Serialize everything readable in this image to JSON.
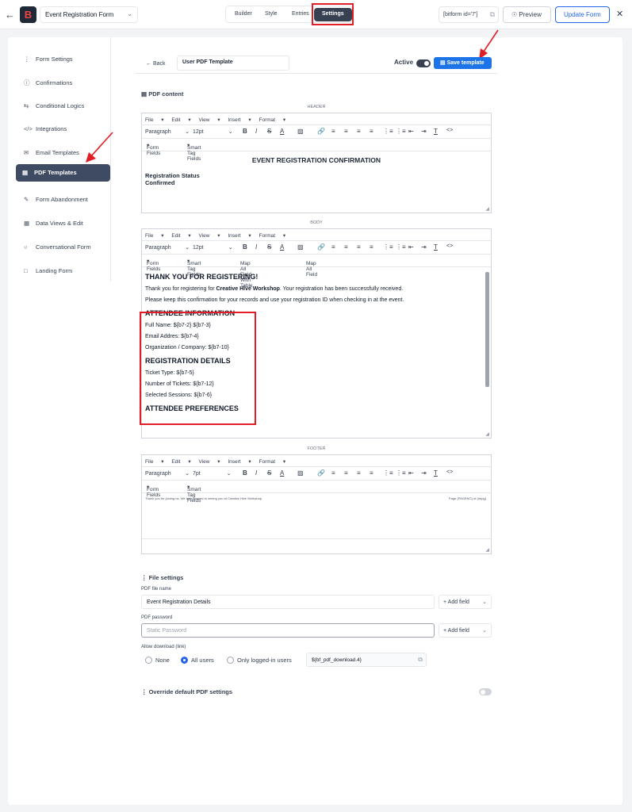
{
  "topbar": {
    "back_icon": "arrow-left-icon",
    "form_name": "Event Registration Form",
    "nav": [
      "Builder",
      "Style",
      "Entries",
      "Settings"
    ],
    "active_nav": "Settings",
    "shortcode": "[bitform id='7']",
    "preview_label": "Preview",
    "update_label": "Update Form"
  },
  "sidebar": {
    "items": [
      {
        "label": "Form Settings",
        "icon": "sliders-icon"
      },
      {
        "label": "Confirmations",
        "icon": "info-circle-icon"
      },
      {
        "label": "Conditional Logics",
        "icon": "branch-icon"
      },
      {
        "label": "Integrations",
        "icon": "code-icon"
      },
      {
        "label": "Email Templates",
        "icon": "mail-icon"
      },
      {
        "label": "PDF Templates",
        "icon": "file-icon"
      },
      {
        "label": "Form Abandonment",
        "icon": "form-icon"
      },
      {
        "label": "Data Views & Edit",
        "icon": "table-icon"
      },
      {
        "label": "Conversational Form",
        "icon": "chat-icon"
      },
      {
        "label": "Landing Form",
        "icon": "page-icon"
      }
    ],
    "active": "PDF Templates"
  },
  "header_row": {
    "back_label": "Back",
    "template_name": "User PDF Template",
    "active_label": "Active",
    "save_label": "Save template"
  },
  "pdf_content": {
    "title": "PDF content",
    "header_label": "HEADER",
    "body_label": "BODY",
    "footer_label": "FOOTER",
    "menu": [
      "File",
      "Edit",
      "View",
      "Insert",
      "Format"
    ],
    "paragraph": "Paragraph",
    "size_header": "12pt",
    "size_body": "12pt",
    "size_footer": "7pt",
    "form_fields": "Form Fields",
    "smart_tags": "Smart Tag Fields",
    "map_all_table": "Map All Field With Table",
    "map_all": "Map All Field"
  },
  "header_editor": {
    "title": "EVENT REGISTRATION CONFIRMATION",
    "status_label": "Registration Status",
    "status_value": "Confirmed"
  },
  "body_editor": {
    "heading": "THANK YOU FOR REGISTERING!",
    "line1_pre": "Thank you for registering for ",
    "line1_bold": "Creative Hive Workshop",
    "line1_post": ". Your registration has been successfully received.",
    "line2": "Please keep this confirmation for your records and use your registration ID when checking in at the event.",
    "attendee_heading": "ATTENDEE INFORMATION",
    "full_name": "Full Name: ${b7-2} ${b7-3}",
    "email": "Email Addres: ${b7-4}",
    "org": "Organization / Company: ${b7-10}",
    "reg_heading": "REGISTRATION DETAILS",
    "ticket": "Ticket Type: ${b7-5}",
    "num_tickets": "Number of Tickets: ${b7-12}",
    "sessions": "Selected Sessions: ${b7-6}",
    "cut_heading": "ATTENDEE PREFERENCES"
  },
  "footer_editor": {
    "left": "Thank you for joining us. We look forward to seeing you at Creative Hive Workshop.",
    "right": "Page {PAGENO} of {nbpg}"
  },
  "file_settings": {
    "title": "File settings",
    "file_name_label": "PDF file name",
    "file_name_value": "Event Registration Details",
    "add_field": "+ Add field",
    "password_label": "PDF password",
    "password_placeholder": "Static Password",
    "download_label": "Allow download (link)",
    "options": [
      "None",
      "All users",
      "Only logged-in users"
    ],
    "selected_option": "All users",
    "download_shortcode": "${bf_pdf_download.4}"
  },
  "override": {
    "label": "Override default PDF settings"
  }
}
